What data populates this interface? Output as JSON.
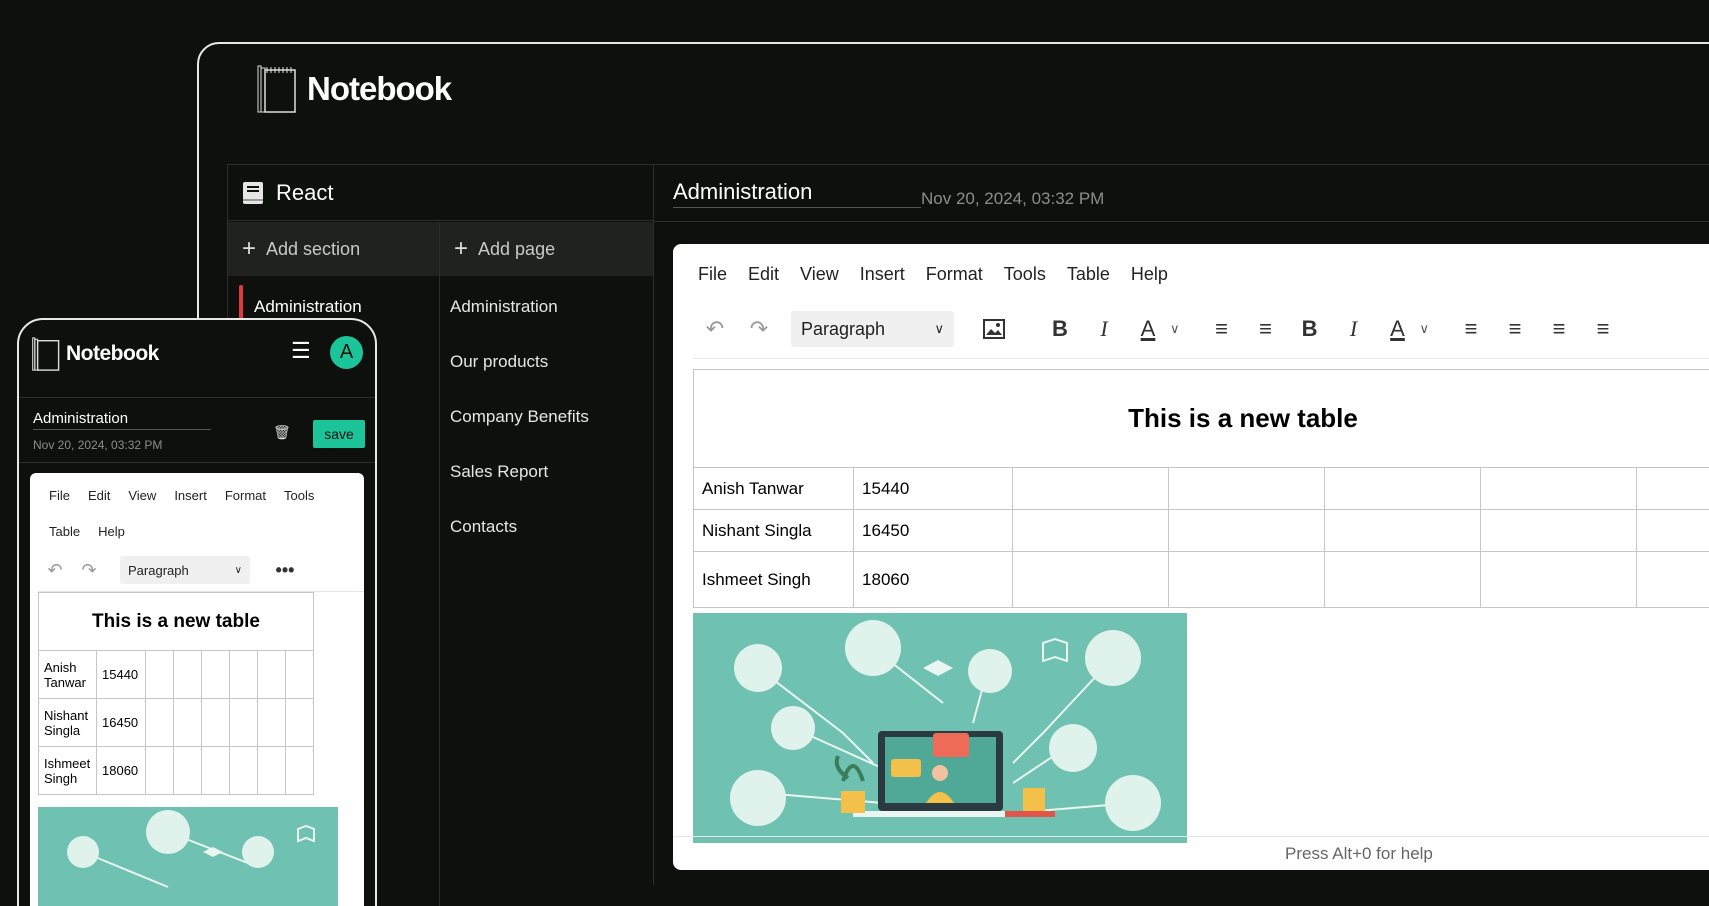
{
  "brand": {
    "name": "Notebook"
  },
  "notebook": {
    "title": "React"
  },
  "sidebar": {
    "add_section_label": "Add section",
    "add_page_label": "Add page",
    "sections": [
      {
        "label": "Administration",
        "active": true
      }
    ],
    "pages": [
      {
        "label": "Administration"
      },
      {
        "label": "Our products"
      },
      {
        "label": "Company Benefits"
      },
      {
        "label": "Sales Report"
      },
      {
        "label": "Contacts"
      }
    ]
  },
  "page": {
    "title": "Administration",
    "date": "Nov 20, 2024, 03:32 PM"
  },
  "editor": {
    "menu": [
      "File",
      "Edit",
      "View",
      "Insert",
      "Format",
      "Tools",
      "Table",
      "Help"
    ],
    "block_format": "Paragraph",
    "status_hint": "Press Alt+0 for help",
    "table": {
      "caption": "This is a new table",
      "rows": [
        {
          "name": "Anish Tanwar",
          "value": "15440"
        },
        {
          "name": "Nishant Singla",
          "value": "16450"
        },
        {
          "name": "Ishmeet Singh",
          "value": "18060"
        }
      ]
    }
  },
  "mobile": {
    "avatar_initial": "A",
    "save_label": "save",
    "menu": [
      "File",
      "Edit",
      "View",
      "Insert",
      "Format",
      "Tools",
      "Table",
      "Help"
    ],
    "rows": [
      {
        "first": "Anish",
        "last": "Tanwar",
        "value": "15440"
      },
      {
        "first": "Nishant",
        "last": "Singla",
        "value": "16450"
      },
      {
        "first": "Ishmeet",
        "last": "Singh",
        "value": "18060"
      }
    ]
  },
  "colors": {
    "accent": "#1cc49a",
    "active_marker": "#e0383d",
    "background": "#0e100e",
    "illustration_bg": "#6fc1b1"
  },
  "icons": [
    "notebook-logo-icon",
    "book-icon",
    "plus-icon",
    "undo-icon",
    "redo-icon",
    "image-icon",
    "bold-icon",
    "italic-icon",
    "text-color-icon",
    "align-left-icon",
    "align-center-icon",
    "align-right-icon",
    "align-justify-icon",
    "hamburger-icon",
    "trash-icon",
    "more-icon"
  ]
}
